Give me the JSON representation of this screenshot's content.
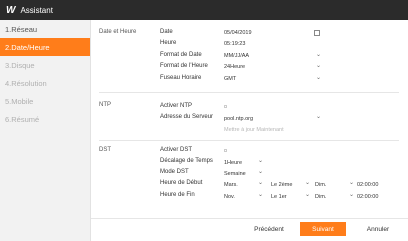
{
  "titlebar": {
    "logo": "W",
    "title": "Assistant"
  },
  "steps": [
    "1.Réseau",
    "2.Date/Heure",
    "3.Disque",
    "4.Résolution",
    "5.Mobile",
    "6.Résumé"
  ],
  "active_step": 1,
  "sections": {
    "date": "Date et Heure",
    "ntp": "NTP",
    "dst": "DST"
  },
  "datetime": {
    "date_label": "Date",
    "date_value": "05/04/2019",
    "time_label": "Heure",
    "time_value": "05:19:23",
    "date_format_label": "Format de Date",
    "date_format_value": "MM/JJ/AA",
    "time_format_label": "Format de l'Heure",
    "time_format_value": "24Heure",
    "timezone_label": "Fuseau Horaire",
    "timezone_value": "GMT"
  },
  "ntp": {
    "enable_label": "Activer NTP",
    "server_label": "Adresse du Serveur",
    "server_value": "pool.ntp.org",
    "update_link": "Mettre à jour Maintenant"
  },
  "dst": {
    "enable_label": "Activer DST",
    "offset_label": "Décalage de Temps",
    "offset_value": "1Heure",
    "mode_label": "Mode DST",
    "mode_value": "Semaine",
    "start_label": "Heure de Début",
    "start_month": "Mars.",
    "start_week": "Le 2ème",
    "start_day": "Dim.",
    "start_time": "02:00:00",
    "end_label": "Heure de Fin",
    "end_month": "Nov.",
    "end_week": "Le 1er",
    "end_day": "Dim.",
    "end_time": "02:00:00"
  },
  "buttons": {
    "prev": "Précédent",
    "next": "Suivant",
    "cancel": "Annuler"
  }
}
